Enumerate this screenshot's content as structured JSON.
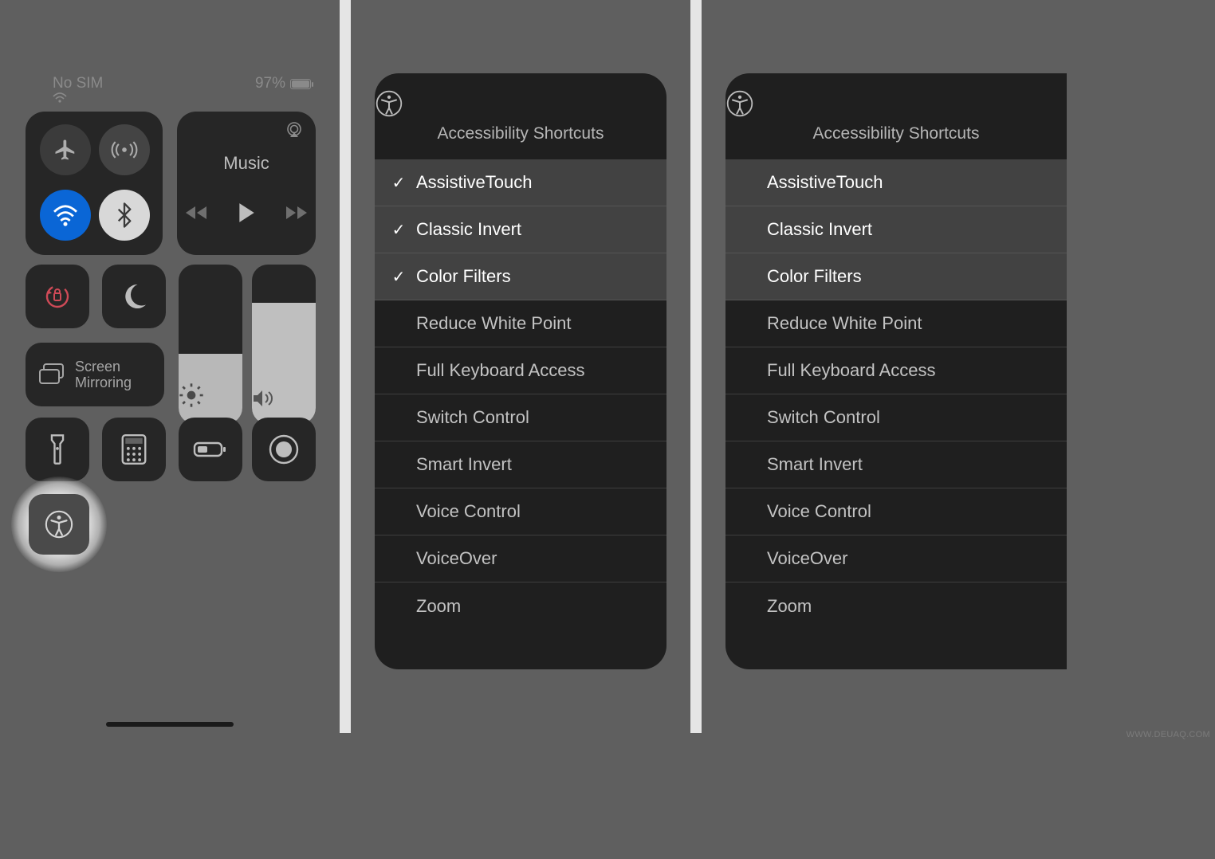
{
  "status": {
    "sim": "No SIM",
    "battery_pct": "97%"
  },
  "control_center": {
    "music_label": "Music",
    "screen_mirroring_l1": "Screen",
    "screen_mirroring_l2": "Mirroring"
  },
  "sheet": {
    "title": "Accessibility Shortcuts",
    "items": [
      {
        "label": "AssistiveTouch",
        "selected_p2": true,
        "checked_p2": true
      },
      {
        "label": "Classic Invert",
        "selected_p2": true,
        "checked_p2": true
      },
      {
        "label": "Color Filters",
        "selected_p2": true,
        "checked_p2": true
      },
      {
        "label": "Reduce White Point",
        "selected_p2": false,
        "checked_p2": false
      },
      {
        "label": "Full Keyboard Access",
        "selected_p2": false,
        "checked_p2": false
      },
      {
        "label": "Switch Control",
        "selected_p2": false,
        "checked_p2": false
      },
      {
        "label": "Smart Invert",
        "selected_p2": false,
        "checked_p2": false
      },
      {
        "label": "Voice Control",
        "selected_p2": false,
        "checked_p2": false
      },
      {
        "label": "VoiceOver",
        "selected_p2": false,
        "checked_p2": false
      },
      {
        "label": "Zoom",
        "selected_p2": false,
        "checked_p2": false
      }
    ]
  },
  "watermark": "WWW.DEUAQ.COM"
}
